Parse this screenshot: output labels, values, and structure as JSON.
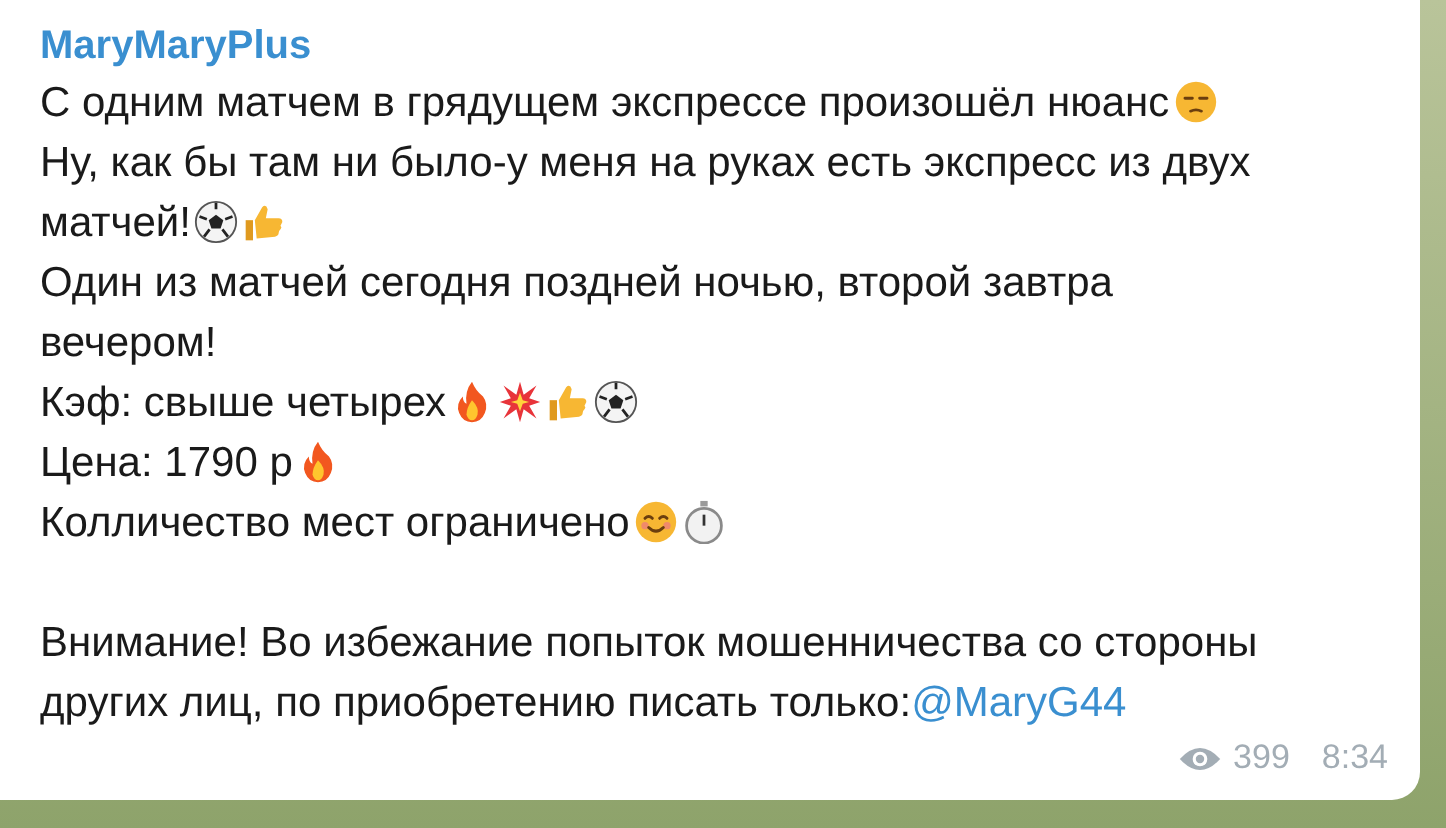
{
  "message": {
    "author": "MaryMaryPlus",
    "paragraphs": [
      {
        "lines": [
          "С одним матчем в грядущем экспрессе произошёл нюанс"
        ],
        "icons": [
          {
            "kind": "unamused"
          }
        ]
      },
      {
        "lines": [
          "Ну, как бы там ни было-у меня на руках есть экспресс из двух",
          "матчей!"
        ],
        "icons": [
          {
            "kind": "ball"
          },
          {
            "kind": "thumb"
          }
        ]
      },
      {
        "lines": [
          "Один из матчей сегодня поздней ночью, второй завтра",
          "вечером!"
        ]
      },
      {
        "lines": [
          "Кэф: свыше четырех"
        ],
        "icons": [
          {
            "kind": "fire"
          },
          {
            "kind": "boom"
          },
          {
            "kind": "thumb"
          },
          {
            "kind": "ball"
          }
        ]
      },
      {
        "lines": [
          "Цена: 1790 р"
        ],
        "icons": [
          {
            "kind": "fire"
          }
        ]
      },
      {
        "lines": [
          "Колличество мест ограничено"
        ],
        "icons": [
          {
            "kind": "smile"
          },
          {
            "kind": "stopwatch"
          }
        ]
      }
    ],
    "notice": {
      "lines": [
        "Внимание! Во избежание попыток мошенничества со стороны",
        "других лиц, по приобретению писать только:"
      ],
      "link": "@MaryG44"
    },
    "views": "399",
    "time": "8:34"
  }
}
